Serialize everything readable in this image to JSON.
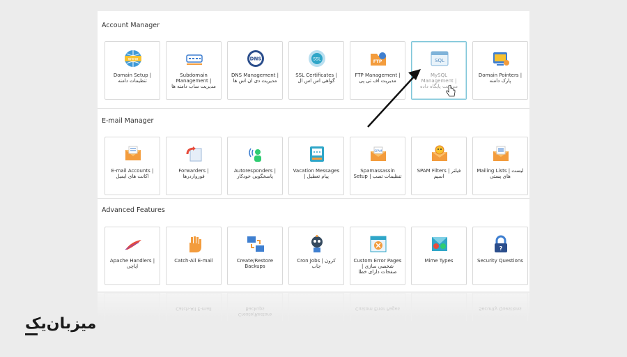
{
  "sections": [
    {
      "title": "Account Manager",
      "items": [
        {
          "label": "Domain Setup | تنظیمات دامنه",
          "icon": "www-globe-icon"
        },
        {
          "label": "Subdomain Management | مدیریت ساب دامنه ها",
          "icon": "subdomain-icon"
        },
        {
          "label": "DNS Management | مدیریت دی ان اس ها",
          "icon": "dns-icon"
        },
        {
          "label": "SSL Certificates | گواهی اس اس ال",
          "icon": "ssl-badge-icon"
        },
        {
          "label": "FTP Management | مدیریت اف تی پی",
          "icon": "ftp-folder-icon"
        },
        {
          "label": "MySQL Management | مدیریت پایگاه داده",
          "icon": "sql-window-icon"
        },
        {
          "label": "Domain Pointers | پارک دامنه",
          "icon": "domain-pointer-icon"
        }
      ]
    },
    {
      "title": "E-mail Manager",
      "items": [
        {
          "label": "E-mail Accounts | اکانت های ایمیل",
          "icon": "email-accounts-icon"
        },
        {
          "label": "Forwarders | فورواردرها",
          "icon": "forwarders-icon"
        },
        {
          "label": "Autoresponders | پاسخگویی خودکار",
          "icon": "autoresponder-icon"
        },
        {
          "label": "Vacation Messages | پیام تعطیل",
          "icon": "vacation-icon"
        },
        {
          "label": "Spamassassin Setup | تنظیمات تصب",
          "icon": "spamassassin-icon"
        },
        {
          "label": "SPAM Filters | فیلتر اسپم",
          "icon": "spam-filter-icon"
        },
        {
          "label": "Mailing Lists | لیست های پستی",
          "icon": "mailing-list-icon"
        }
      ]
    },
    {
      "title": "Advanced Features",
      "items": [
        {
          "label": "Apache Handlers | اپاچی",
          "icon": "apache-feather-icon"
        },
        {
          "label": "Catch-All E-mail",
          "icon": "catch-all-hand-icon"
        },
        {
          "label": "Create/Restore Backups",
          "icon": "backup-icon"
        },
        {
          "label": "Cron Jobs | کرون جاب",
          "icon": "cron-robot-icon"
        },
        {
          "label": "Custom Error Pages | شخصی سازی صفحات دارای خطا",
          "icon": "error-page-icon"
        },
        {
          "label": "Mime Types",
          "icon": "mime-types-icon"
        },
        {
          "label": "Security Questions",
          "icon": "security-lock-icon"
        }
      ]
    }
  ],
  "reflection": [
    "Catch-All E-mail",
    "Create/Restore Backups",
    "Custom Error Pages",
    "Security Questions"
  ],
  "logo": {
    "text": "میزبان‌یک"
  },
  "colors": {
    "orange": "#f39c3d",
    "blue": "#3f7fd0",
    "teal": "#2fa6c8",
    "active_border": "#7fc6d9"
  }
}
